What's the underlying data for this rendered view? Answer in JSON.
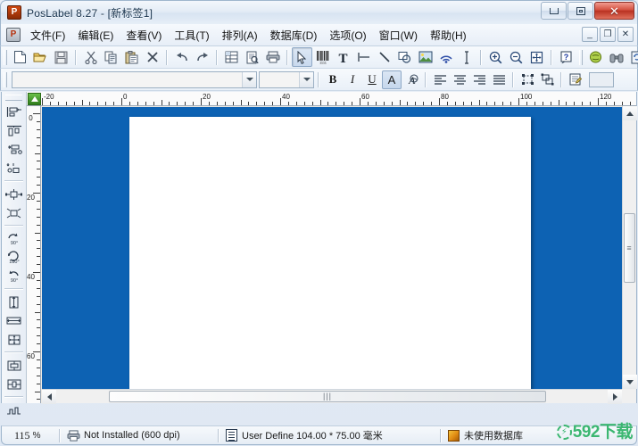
{
  "window": {
    "title": "PosLabel 8.27 - [新标签1]",
    "app_icon": "P",
    "controls": {
      "minimize": "minimize-icon",
      "maximize": "maximize-icon",
      "close": "✕"
    }
  },
  "menubar": {
    "mdi_icon": "P",
    "items": [
      {
        "label": "文件(F)",
        "name": "menu-file"
      },
      {
        "label": "编辑(E)",
        "name": "menu-edit"
      },
      {
        "label": "查看(V)",
        "name": "menu-view"
      },
      {
        "label": "工具(T)",
        "name": "menu-tools"
      },
      {
        "label": "排列(A)",
        "name": "menu-arrange"
      },
      {
        "label": "数据库(D)",
        "name": "menu-database"
      },
      {
        "label": "选项(O)",
        "name": "menu-options"
      },
      {
        "label": "窗口(W)",
        "name": "menu-window"
      },
      {
        "label": "帮助(H)",
        "name": "menu-help"
      }
    ],
    "mdi_controls": {
      "minimize": "_",
      "restore": "❐",
      "close": "✕"
    }
  },
  "toolbar_main": {
    "buttons": [
      {
        "name": "new-document-icon"
      },
      {
        "name": "open-folder-icon"
      },
      {
        "name": "save-disk-icon"
      },
      {
        "name": "cut-scissors-icon"
      },
      {
        "name": "copy-icon"
      },
      {
        "name": "paste-icon"
      },
      {
        "name": "delete-x-icon"
      },
      {
        "name": "undo-icon"
      },
      {
        "name": "redo-icon"
      },
      {
        "name": "page-setup-icon"
      },
      {
        "name": "print-preview-icon"
      },
      {
        "name": "print-icon"
      },
      {
        "name": "select-arrow-icon"
      },
      {
        "name": "barcode-icon"
      },
      {
        "name": "text-tool-icon"
      },
      {
        "name": "horizontal-line-icon"
      },
      {
        "name": "diagonal-line-icon"
      },
      {
        "name": "shape-icon"
      },
      {
        "name": "image-icon"
      },
      {
        "name": "rfid-icon"
      },
      {
        "name": "measure-icon"
      },
      {
        "name": "zoom-in-icon"
      },
      {
        "name": "zoom-out-icon"
      },
      {
        "name": "fit-page-icon"
      },
      {
        "name": "help-icon"
      },
      {
        "name": "package-icon"
      },
      {
        "name": "binoculars-icon"
      },
      {
        "name": "refresh-page-icon"
      }
    ],
    "pressed": "select-arrow-icon"
  },
  "toolbar_format": {
    "font_name": {
      "value": "",
      "placeholder": ""
    },
    "font_size": {
      "value": "",
      "placeholder": ""
    },
    "bold_label": "B",
    "italic_label": "I",
    "underline_label": "U",
    "textcolor_label": "A",
    "effects_name": "font-effects-icon",
    "align_left": "align-left-icon",
    "align_center": "align-center-icon",
    "align_right": "align-right-icon",
    "align_justify": "align-justify-icon",
    "group_name": "group-objects-icon",
    "ungroup_name": "ungroup-objects-icon",
    "properties_name": "properties-icon"
  },
  "vertical_tools": [
    {
      "name": "align-left-edge-icon"
    },
    {
      "name": "align-top-edge-icon"
    },
    {
      "name": "align-right-edge-icon"
    },
    {
      "name": "align-bottom-edge-icon"
    },
    {
      "name": "distribute-horizontal-icon"
    },
    {
      "name": "distribute-vertical-icon"
    },
    {
      "name": "rotate-90-icon",
      "label": "90°"
    },
    {
      "name": "rotate-180-icon",
      "label": "180°"
    },
    {
      "name": "rotate-270-icon",
      "label": "90°"
    },
    {
      "name": "same-height-icon"
    },
    {
      "name": "same-width-icon"
    },
    {
      "name": "same-size-icon"
    },
    {
      "name": "center-vertical-icon"
    },
    {
      "name": "center-horizontal-icon"
    },
    {
      "name": "lock-objects-icon"
    }
  ],
  "rulers": {
    "unit": "毫米",
    "horizontal_labels": [
      "-20",
      "0",
      "20",
      "40",
      "60",
      "80",
      "100",
      "120"
    ],
    "vertical_labels": [
      "0",
      "20",
      "40",
      "60"
    ]
  },
  "canvas": {
    "background_color": "#0d62b3",
    "page_color": "#ffffff",
    "label_name": "label-page"
  },
  "statusbar": {
    "zoom": "115",
    "zoom_unit": "%",
    "printer": "Not Installed (600 dpi)",
    "page_size": "User Define  104.00 * 75.00 毫米",
    "database": "未使用数据库"
  },
  "watermark": {
    "text": "592下载",
    "color": "#35b56c",
    "bolt": "⚡"
  }
}
